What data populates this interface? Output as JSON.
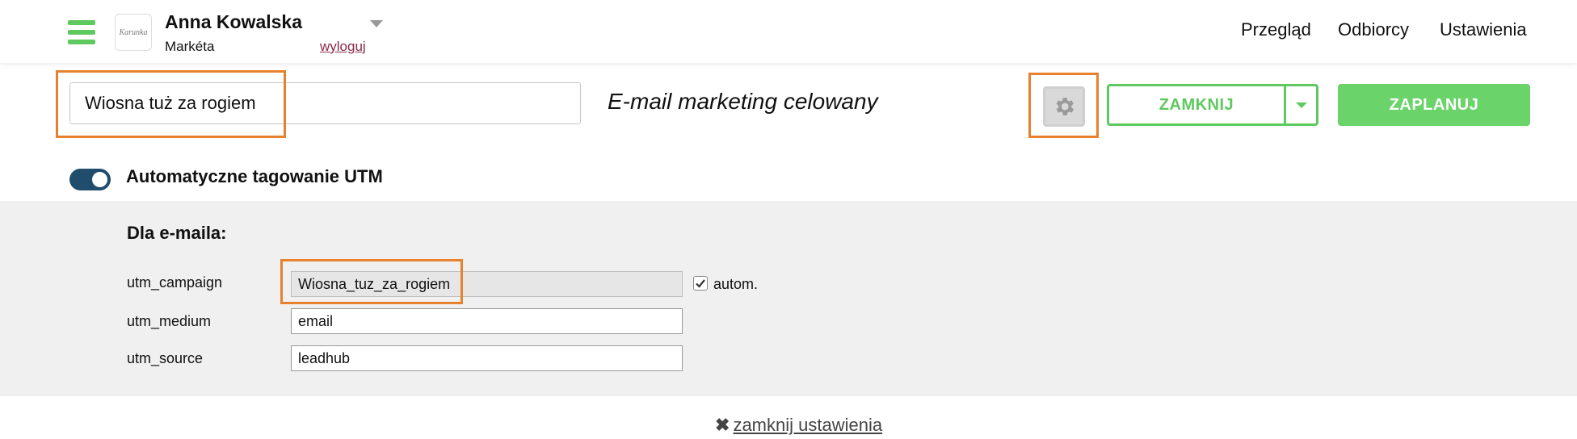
{
  "header": {
    "user_name": "Anna Kowalska",
    "company": "Markéta",
    "logout": "wyloguj",
    "logo_text": "Karunka",
    "nav": [
      "Przegląd",
      "Odbiorcy",
      "Ustawienia"
    ]
  },
  "campaign": {
    "title_value": "Wiosna tuż za rogiem",
    "subtitle": "E-mail marketing celowany",
    "close_label": "ZAMKNIJ",
    "schedule_label": "ZAPLANUJ"
  },
  "utm": {
    "toggle_label": "Automatyczne tagowanie UTM",
    "section_title": "Dla e-maila:",
    "fields": [
      {
        "label": "utm_campaign",
        "value": "Wiosna_tuz_za_rogiem"
      },
      {
        "label": "utm_medium",
        "value": "email"
      },
      {
        "label": "utm_source",
        "value": "leadhub"
      }
    ],
    "auto_label": "autom."
  },
  "footer": {
    "close_settings": "zamknij ustawienia"
  },
  "colors": {
    "accent_green": "#5ec95e",
    "highlight_orange": "#e8812e",
    "toggle_blue": "#1f4d6b"
  }
}
